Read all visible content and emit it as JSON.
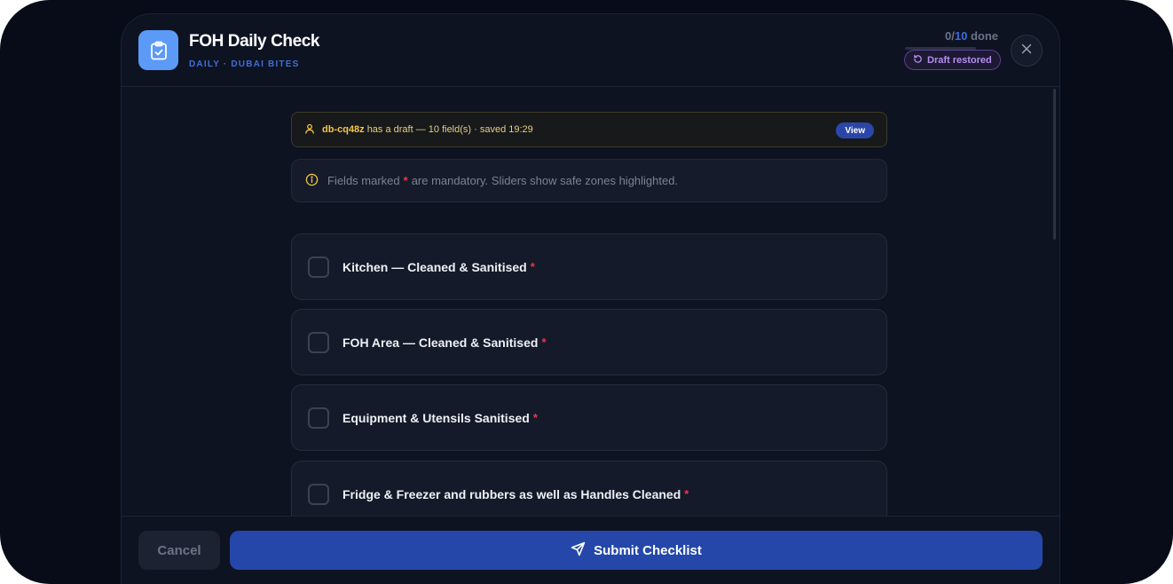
{
  "header": {
    "title": "FOH Daily Check",
    "subtitle": "DAILY · DUBAI BITES",
    "progress": {
      "done": "0",
      "total": "10",
      "suffix": "done",
      "fraction": 0
    },
    "draft_badge": "Draft restored",
    "app_icon": "clipboard-check-icon",
    "close_icon": "close-icon"
  },
  "draft_banner": {
    "user": "db-cq48z",
    "text": "has a draft — 10 field(s) · saved 19:29",
    "view_label": "View"
  },
  "info_banner": {
    "before": "Fields marked",
    "star": "*",
    "after": "are mandatory. Sliders show safe zones highlighted."
  },
  "items": [
    {
      "label": "Kitchen — Cleaned & Sanitised",
      "required": "*"
    },
    {
      "label": "FOH Area — Cleaned & Sanitised",
      "required": "*"
    },
    {
      "label": "Equipment & Utensils Sanitised",
      "required": "*"
    },
    {
      "label": "Fridge & Freezer and rubbers as well as Handles Cleaned",
      "required": "*"
    }
  ],
  "footer": {
    "cancel_label": "Cancel",
    "submit_label": "Submit Checklist"
  },
  "colors": {
    "accent": "#2447a9",
    "brand_icon": "#5c9af7",
    "required": "#e8394a",
    "draft_text": "#f4c64a",
    "badge_purple": "#b38ef0"
  }
}
